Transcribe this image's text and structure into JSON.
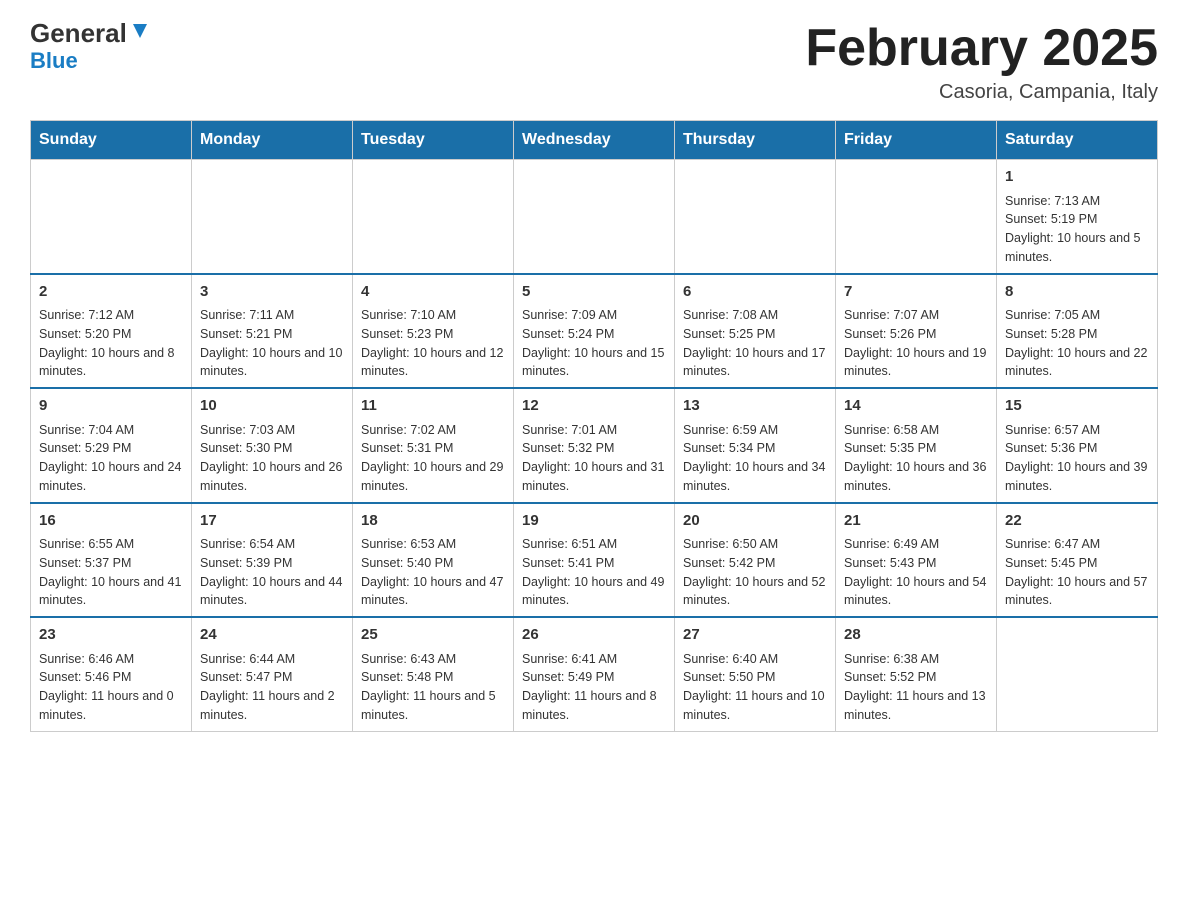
{
  "header": {
    "logo_main": "General",
    "logo_sub": "Blue",
    "month_title": "February 2025",
    "location": "Casoria, Campania, Italy"
  },
  "weekdays": [
    "Sunday",
    "Monday",
    "Tuesday",
    "Wednesday",
    "Thursday",
    "Friday",
    "Saturday"
  ],
  "weeks": [
    [
      {
        "day": "",
        "info": ""
      },
      {
        "day": "",
        "info": ""
      },
      {
        "day": "",
        "info": ""
      },
      {
        "day": "",
        "info": ""
      },
      {
        "day": "",
        "info": ""
      },
      {
        "day": "",
        "info": ""
      },
      {
        "day": "1",
        "info": "Sunrise: 7:13 AM\nSunset: 5:19 PM\nDaylight: 10 hours and 5 minutes."
      }
    ],
    [
      {
        "day": "2",
        "info": "Sunrise: 7:12 AM\nSunset: 5:20 PM\nDaylight: 10 hours and 8 minutes."
      },
      {
        "day": "3",
        "info": "Sunrise: 7:11 AM\nSunset: 5:21 PM\nDaylight: 10 hours and 10 minutes."
      },
      {
        "day": "4",
        "info": "Sunrise: 7:10 AM\nSunset: 5:23 PM\nDaylight: 10 hours and 12 minutes."
      },
      {
        "day": "5",
        "info": "Sunrise: 7:09 AM\nSunset: 5:24 PM\nDaylight: 10 hours and 15 minutes."
      },
      {
        "day": "6",
        "info": "Sunrise: 7:08 AM\nSunset: 5:25 PM\nDaylight: 10 hours and 17 minutes."
      },
      {
        "day": "7",
        "info": "Sunrise: 7:07 AM\nSunset: 5:26 PM\nDaylight: 10 hours and 19 minutes."
      },
      {
        "day": "8",
        "info": "Sunrise: 7:05 AM\nSunset: 5:28 PM\nDaylight: 10 hours and 22 minutes."
      }
    ],
    [
      {
        "day": "9",
        "info": "Sunrise: 7:04 AM\nSunset: 5:29 PM\nDaylight: 10 hours and 24 minutes."
      },
      {
        "day": "10",
        "info": "Sunrise: 7:03 AM\nSunset: 5:30 PM\nDaylight: 10 hours and 26 minutes."
      },
      {
        "day": "11",
        "info": "Sunrise: 7:02 AM\nSunset: 5:31 PM\nDaylight: 10 hours and 29 minutes."
      },
      {
        "day": "12",
        "info": "Sunrise: 7:01 AM\nSunset: 5:32 PM\nDaylight: 10 hours and 31 minutes."
      },
      {
        "day": "13",
        "info": "Sunrise: 6:59 AM\nSunset: 5:34 PM\nDaylight: 10 hours and 34 minutes."
      },
      {
        "day": "14",
        "info": "Sunrise: 6:58 AM\nSunset: 5:35 PM\nDaylight: 10 hours and 36 minutes."
      },
      {
        "day": "15",
        "info": "Sunrise: 6:57 AM\nSunset: 5:36 PM\nDaylight: 10 hours and 39 minutes."
      }
    ],
    [
      {
        "day": "16",
        "info": "Sunrise: 6:55 AM\nSunset: 5:37 PM\nDaylight: 10 hours and 41 minutes."
      },
      {
        "day": "17",
        "info": "Sunrise: 6:54 AM\nSunset: 5:39 PM\nDaylight: 10 hours and 44 minutes."
      },
      {
        "day": "18",
        "info": "Sunrise: 6:53 AM\nSunset: 5:40 PM\nDaylight: 10 hours and 47 minutes."
      },
      {
        "day": "19",
        "info": "Sunrise: 6:51 AM\nSunset: 5:41 PM\nDaylight: 10 hours and 49 minutes."
      },
      {
        "day": "20",
        "info": "Sunrise: 6:50 AM\nSunset: 5:42 PM\nDaylight: 10 hours and 52 minutes."
      },
      {
        "day": "21",
        "info": "Sunrise: 6:49 AM\nSunset: 5:43 PM\nDaylight: 10 hours and 54 minutes."
      },
      {
        "day": "22",
        "info": "Sunrise: 6:47 AM\nSunset: 5:45 PM\nDaylight: 10 hours and 57 minutes."
      }
    ],
    [
      {
        "day": "23",
        "info": "Sunrise: 6:46 AM\nSunset: 5:46 PM\nDaylight: 11 hours and 0 minutes."
      },
      {
        "day": "24",
        "info": "Sunrise: 6:44 AM\nSunset: 5:47 PM\nDaylight: 11 hours and 2 minutes."
      },
      {
        "day": "25",
        "info": "Sunrise: 6:43 AM\nSunset: 5:48 PM\nDaylight: 11 hours and 5 minutes."
      },
      {
        "day": "26",
        "info": "Sunrise: 6:41 AM\nSunset: 5:49 PM\nDaylight: 11 hours and 8 minutes."
      },
      {
        "day": "27",
        "info": "Sunrise: 6:40 AM\nSunset: 5:50 PM\nDaylight: 11 hours and 10 minutes."
      },
      {
        "day": "28",
        "info": "Sunrise: 6:38 AM\nSunset: 5:52 PM\nDaylight: 11 hours and 13 minutes."
      },
      {
        "day": "",
        "info": ""
      }
    ]
  ]
}
